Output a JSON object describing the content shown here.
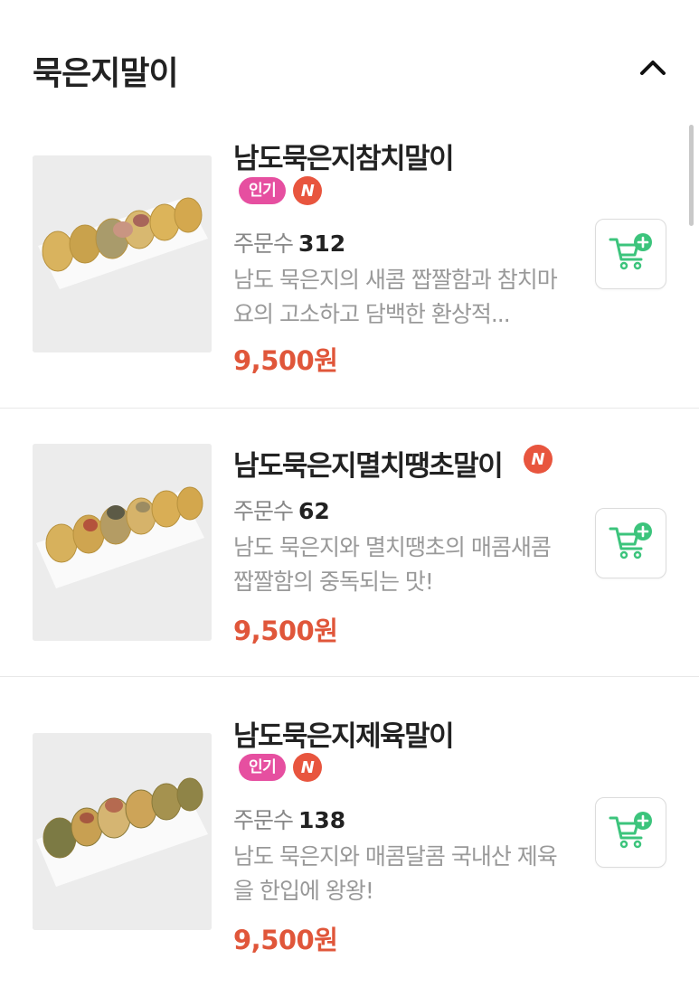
{
  "section": {
    "title": "묵은지말이",
    "collapse_icon": "chevron-up-icon"
  },
  "colors": {
    "price": "#e0563a",
    "popular_badge": "#e64fa0",
    "new_badge": "#e8553e",
    "cart_icon": "#3cc47c"
  },
  "labels": {
    "order_count_prefix": "주문수",
    "popular_badge": "인기",
    "new_badge": "N"
  },
  "items": [
    {
      "name": "남도묵은지참치말이",
      "order_count": "312",
      "description": "남도 묵은지의 새콤 짭짤함과 참치마요의 고소하고 담백한 환상적...",
      "price": "9,500원"
    },
    {
      "name": "남도묵은지멸치땡초말이",
      "order_count": "62",
      "description": "남도 묵은지와 멸치땡초의 매콤새콤짭짤함의 중독되는 맛!",
      "price": "9,500원"
    },
    {
      "name": "남도묵은지제육말이",
      "order_count": "138",
      "description": "남도 묵은지와 매콤달콤 국내산 제육을 한입에 왕왕!",
      "price": "9,500원"
    }
  ]
}
